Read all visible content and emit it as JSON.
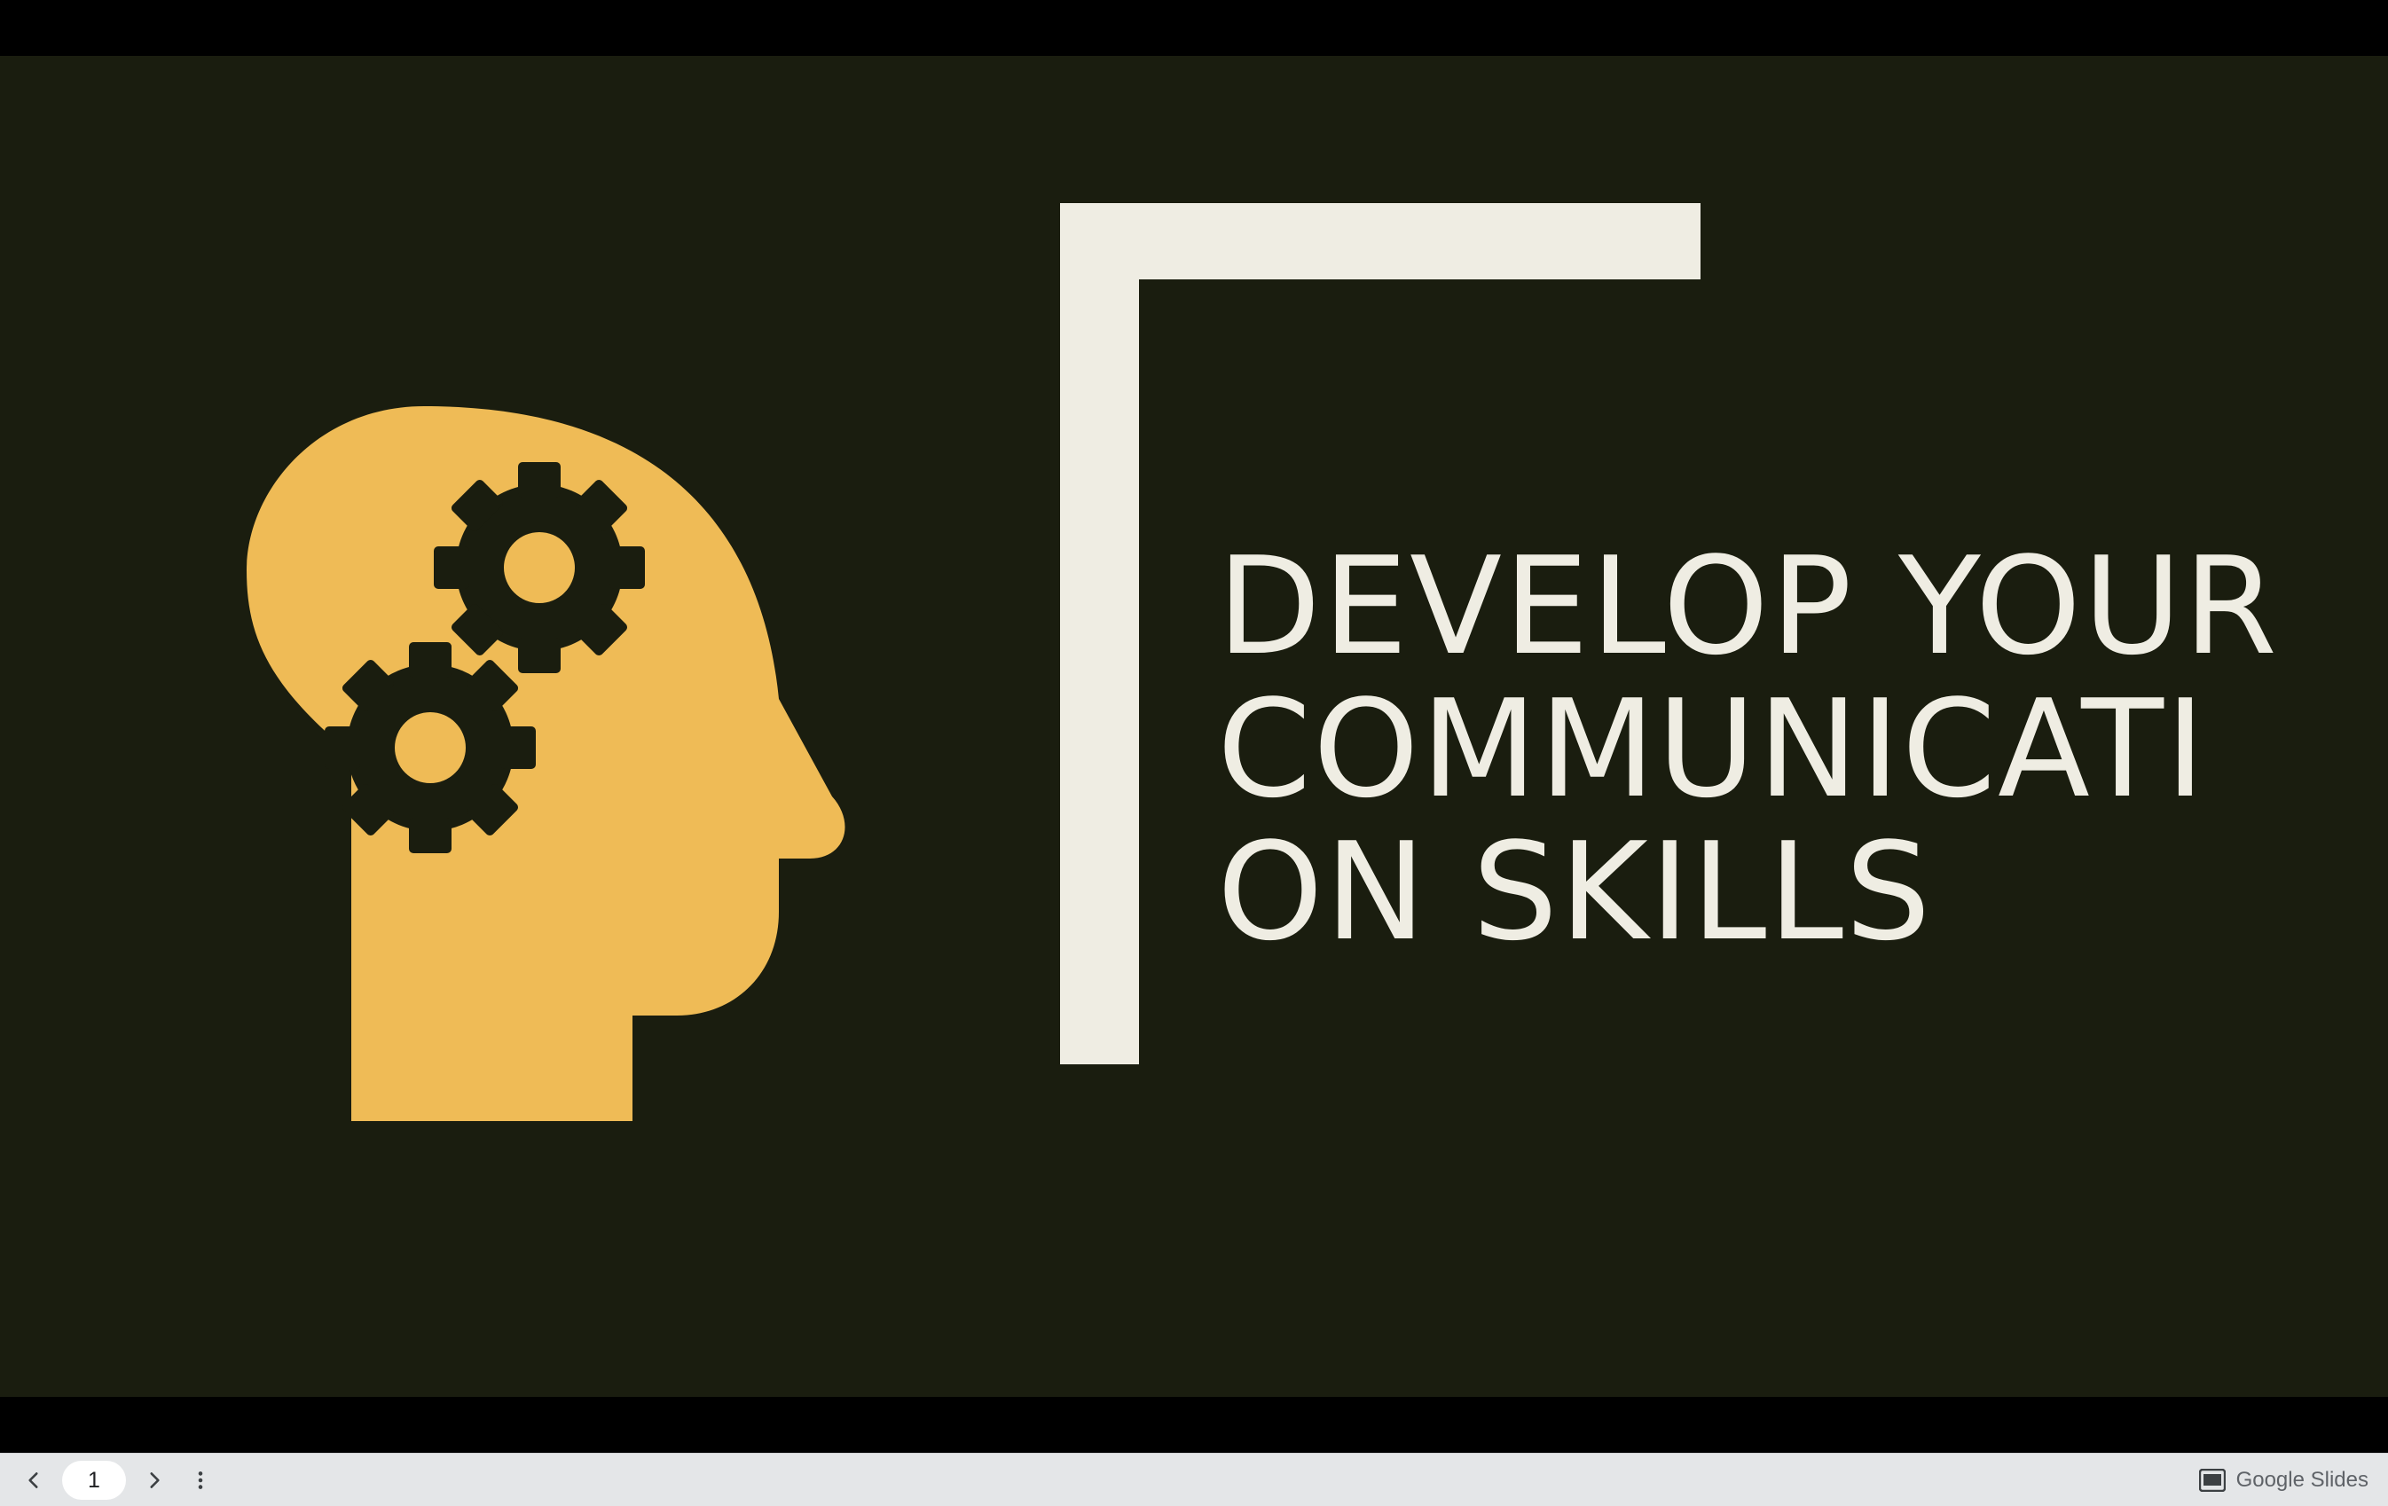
{
  "slide": {
    "title": "DEVELOP YOUR\nCOMMUNICATI\nON SKILLS",
    "background_color": "#1a1d0f",
    "accent_color": "#efbb56",
    "frame_color": "#efede3",
    "icon": "head-with-gears-icon"
  },
  "controls": {
    "prev_icon": "chevron-left-icon",
    "next_icon": "chevron-right-icon",
    "more_icon": "more-vert-icon",
    "page_value": "1",
    "brand_icon": "slides-logo-icon",
    "brand_label": "Google Slides"
  }
}
